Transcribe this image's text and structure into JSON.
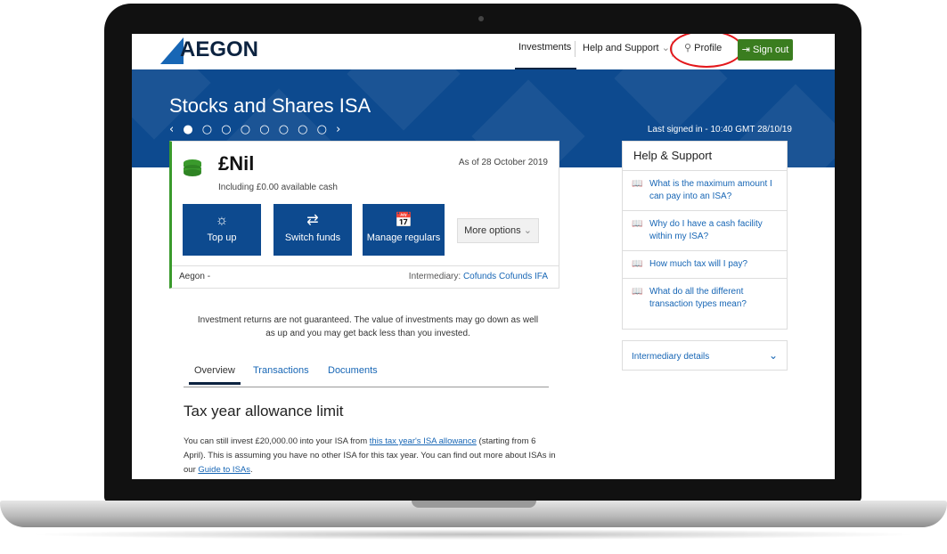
{
  "header": {
    "logo_text": "AEGON",
    "nav_investments": "Investments",
    "nav_help": "Help and Support",
    "profile": "Profile",
    "sign_out": "Sign out"
  },
  "banner": {
    "title": "Stocks and Shares ISA",
    "carousel": "‹ ● ○ ○ ○ ○ ○ ○ ○ ›",
    "last_signed": "Last signed in - 10:40 GMT 28/10/19"
  },
  "account": {
    "amount": "£Nil",
    "as_of": "As of 28 October 2019",
    "cash": "Including £0.00 available cash",
    "actions": [
      "Top up",
      "Switch funds",
      "Manage regulars"
    ],
    "more": "More options",
    "provider": "Aegon -",
    "intermediary_label": "Intermediary:",
    "intermediary_name": "Cofunds Cofunds IFA"
  },
  "disclaimer": "Investment returns are not guaranteed. The value of investments may go down as well as up and you may get back less than you invested.",
  "tabs": [
    "Overview",
    "Transactions",
    "Documents"
  ],
  "tax": {
    "heading": "Tax year allowance limit",
    "p1": "You can still invest £20,000.00 into your ISA from",
    "link1": "this tax year's ISA allowance",
    "p2": "(starting from 6 April). This is assuming you have no other ISA for this tax year. You can find out more about ISAs in our",
    "link2": "Guide to ISAs",
    "p3": "."
  },
  "help": {
    "title": "Help & Support",
    "items": [
      "What is the maximum amount I can pay into an ISA?",
      "Why do I have a cash facility within my ISA?",
      "How much tax will I pay?",
      "What do all the different transaction types mean?"
    ],
    "intermediary_details": "Intermediary details"
  },
  "colors": {
    "brand_blue": "#0d4a8f",
    "sign_out_green": "#3a7d1f",
    "annotation_red": "#e3171b"
  }
}
